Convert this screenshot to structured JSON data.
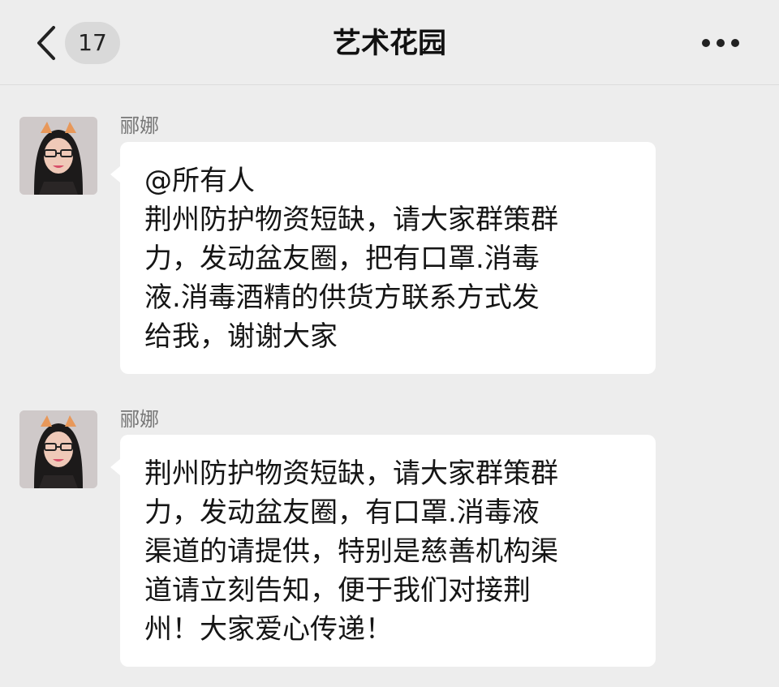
{
  "header": {
    "unread_count": "17",
    "title": "艺术花园",
    "back_icon": "chevron-left-icon",
    "more_icon": "more-horizontal-icon"
  },
  "messages": [
    {
      "sender": "郦娜",
      "text": "@所有人\n荆州防护物资短缺，请大家群策群\n力，发动盆友圈，把有口罩.消毒\n液.消毒酒精的供货方联系方式发\n给我，谢谢大家"
    },
    {
      "sender": "郦娜",
      "text": "荆州防护物资短缺，请大家群策群\n力，发动盆友圈，有口罩.消毒液\n渠道的请提供，特别是慈善机构渠\n道请立刻告知，便于我们对接荆\n州！大家爱心传递！"
    }
  ],
  "colors": {
    "background": "#ededed",
    "bubble": "#ffffff",
    "badge": "#d9d9d9"
  }
}
